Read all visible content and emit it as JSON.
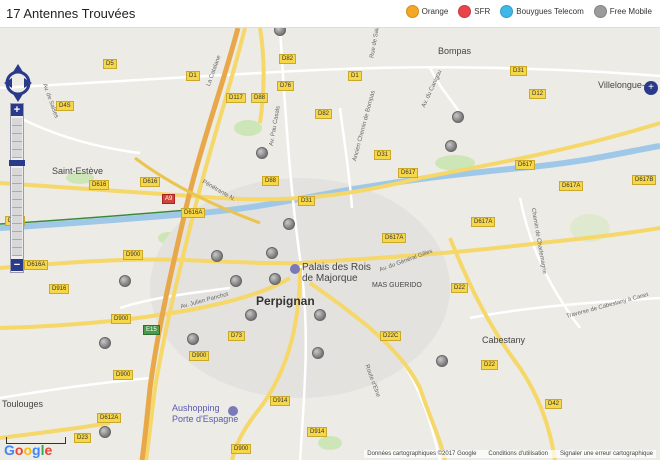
{
  "header": {
    "title": "17 Antennes Trouvées",
    "legend": [
      {
        "label": "Orange",
        "color": "#f5a623"
      },
      {
        "label": "SFR",
        "color": "#e8444a"
      },
      {
        "label": "Bouygues Telecom",
        "color": "#3fb7e8"
      },
      {
        "label": "Free Mobile",
        "color": "#9b9b9b"
      }
    ]
  },
  "map": {
    "places": {
      "saint_esteve": "Saint-Estève",
      "bompas": "Bompas",
      "villelongue": "Villelongue-de",
      "perpignan": "Perpignan",
      "palais": "Palais des Rois",
      "majorque": "de Majorque",
      "mas_guerido": "MAS GUERIDO",
      "cabestany": "Cabestany",
      "aushopping": "Aushopping",
      "porte": "Porte d'Espagne",
      "toulouges": "Toulouges"
    },
    "roads": {
      "d5": "D5",
      "d4s": "D4S",
      "d1a": "D1",
      "d1b": "D1",
      "d82a": "D82",
      "d76": "D76",
      "d117": "D117",
      "d88a": "D88",
      "d82b": "D82",
      "d31a": "D31",
      "d12": "D12",
      "d31b": "D31",
      "d617a": "D617",
      "d617b": "D617",
      "d617c": "D617A",
      "d617d": "D617B",
      "d616a": "D616",
      "d616b": "D616",
      "d616c": "D616A",
      "d88b": "D88",
      "d31c": "D31",
      "d617e": "D617A",
      "d617f": "D617A",
      "d900a": "D900",
      "d616d": "D616A",
      "d916": "D916",
      "d900b": "D900",
      "e15": "E15",
      "d73": "D73",
      "d900c": "D900",
      "d22": "D22",
      "d22c": "D22C",
      "d900d": "D900",
      "d914a": "D914",
      "d914b": "D914",
      "d612a": "D612A",
      "d23": "D23",
      "d900e": "D900",
      "d42": "D42",
      "d617g": "D617",
      "a9": "A9",
      "d616e": "D616",
      "d22b": "D22"
    },
    "streets": {
      "la_catalane": "La Catalane",
      "av_pau_casals": "Av. Pau Casals",
      "chemin_bompas": "Ancien Chemin de Bompas",
      "av_salses": "Av. de Salses",
      "penetrante": "Pénétrante N.",
      "av_general_gilles": "Av. du Général Gilles",
      "chemin_charlemagne": "Chemin de Charlemagne",
      "traverse": "Traverse de Cabestany à Canet",
      "av_julien": "Av. Julien Panchot",
      "route_elne": "Route d'Elne",
      "av_canigou": "Av. du Canigou",
      "rue": "Rue de Saint"
    },
    "antenna_type": "free-mobile"
  },
  "footer": {
    "google": "Google",
    "copyright": "Données cartographiques ©2017 Google",
    "terms": "Conditions d'utilisation",
    "report": "Signaler une erreur cartographique"
  },
  "controls": {
    "zoom_in": "+",
    "zoom_out": "−",
    "pan_right": "+"
  }
}
